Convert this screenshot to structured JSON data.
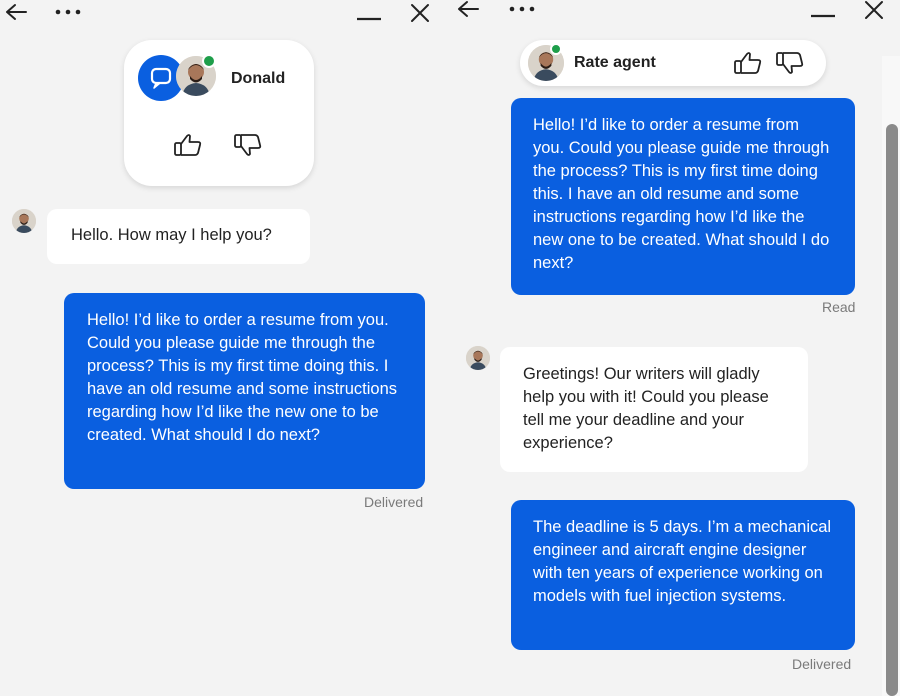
{
  "colors": {
    "accent": "#0a5fe0",
    "online": "#1e9e4a",
    "background": "#f3f3f3",
    "status_text": "#7a7a7a"
  },
  "left": {
    "window_controls": {
      "back_icon": "arrow-left-icon",
      "more_icon": "more-horizontal-icon",
      "minimize_icon": "minimize-icon",
      "close_icon": "close-icon"
    },
    "agent_card": {
      "name": "Donald",
      "chat_icon": "chat-bubble-icon",
      "like_icon": "thumbs-up-icon",
      "dislike_icon": "thumbs-down-icon"
    },
    "messages": [
      {
        "from": "agent",
        "text": "Hello. How may I help you?"
      },
      {
        "from": "user",
        "text": "Hello! I’d like to order a resume from you. Could you please guide me through the process? This is my first time doing this. I have an old resume and some instructions regarding how I’d like the new one to be created. What should I do next?",
        "status": "Delivered"
      }
    ]
  },
  "right": {
    "rate_bar": {
      "label": "Rate agent",
      "like_icon": "thumbs-up-icon",
      "dislike_icon": "thumbs-down-icon"
    },
    "messages": [
      {
        "from": "user",
        "text": "Hello! I’d like to order a resume from you. Could you please guide me through the process? This is my first time doing this. I have an old resume and some instructions regarding how I’d like the new one to be created. What should I do next?",
        "status": "Read"
      },
      {
        "from": "agent",
        "text": "Greetings! Our writers will gladly help you with it! Could you please tell me your deadline and your experience?"
      },
      {
        "from": "user",
        "text": "The deadline is 5 days. I’m a mechanical engineer and aircraft engine designer with ten years of experience working on models with fuel injection systems.",
        "status": "Delivered"
      }
    ]
  }
}
